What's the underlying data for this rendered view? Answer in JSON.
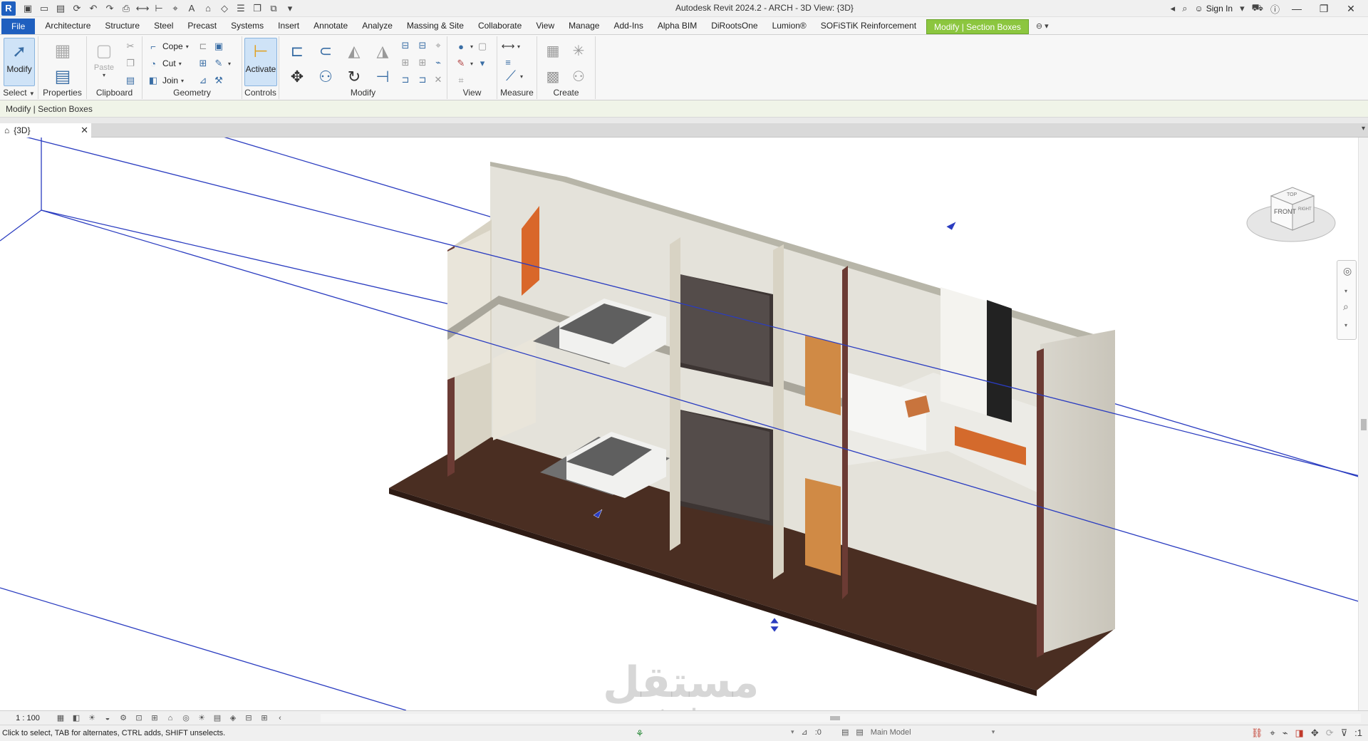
{
  "title_bar": {
    "app_badge": "R",
    "window_title": "Autodesk Revit 2024.2 - ARCH - 3D View: {3D}",
    "sign_in": "Sign In"
  },
  "tabs": [
    {
      "label": "File",
      "kind": "file"
    },
    {
      "label": "Architecture"
    },
    {
      "label": "Structure"
    },
    {
      "label": "Steel"
    },
    {
      "label": "Precast"
    },
    {
      "label": "Systems"
    },
    {
      "label": "Insert"
    },
    {
      "label": "Annotate"
    },
    {
      "label": "Analyze"
    },
    {
      "label": "Massing & Site"
    },
    {
      "label": "Collaborate"
    },
    {
      "label": "View"
    },
    {
      "label": "Manage"
    },
    {
      "label": "Add-Ins"
    },
    {
      "label": "Alpha BIM"
    },
    {
      "label": "DiRootsOne"
    },
    {
      "label": "Lumion®"
    },
    {
      "label": "SOFiSTiK Reinforcement"
    },
    {
      "label": "Modify | Section Boxes",
      "kind": "context"
    }
  ],
  "ribbon": {
    "select": {
      "button": "Modify",
      "panel": "Select"
    },
    "properties": {
      "panel": "Properties"
    },
    "clipboard": {
      "paste": "Paste",
      "panel": "Clipboard"
    },
    "geometry": {
      "cope": "Cope",
      "cut": "Cut",
      "join": "Join",
      "panel": "Geometry"
    },
    "controls": {
      "activate": "Activate",
      "panel": "Controls"
    },
    "modify": {
      "panel": "Modify"
    },
    "view": {
      "panel": "View"
    },
    "measure": {
      "panel": "Measure"
    },
    "create": {
      "panel": "Create"
    }
  },
  "options_bar": {
    "label": "Modify | Section Boxes"
  },
  "view_tab": {
    "label": "{3D}"
  },
  "viewcube": {
    "top": "TOP",
    "front": "FRONT",
    "right": "RIGHT"
  },
  "view_control": {
    "scale": "1 : 100"
  },
  "status": {
    "message": "Click to select, TAB for alternates, CTRL adds, SHIFT unselects.",
    "worksets": ":0",
    "model": "Main Model",
    "filter": ":1"
  },
  "watermark": {
    "arabic": "مستقل",
    "latin": "mostaql.com"
  },
  "colors": {
    "file_tab": "#1f5fbf",
    "context_tab": "#8cc63f",
    "section_box": "#2a3cc0",
    "floor": "#4a2e22"
  }
}
